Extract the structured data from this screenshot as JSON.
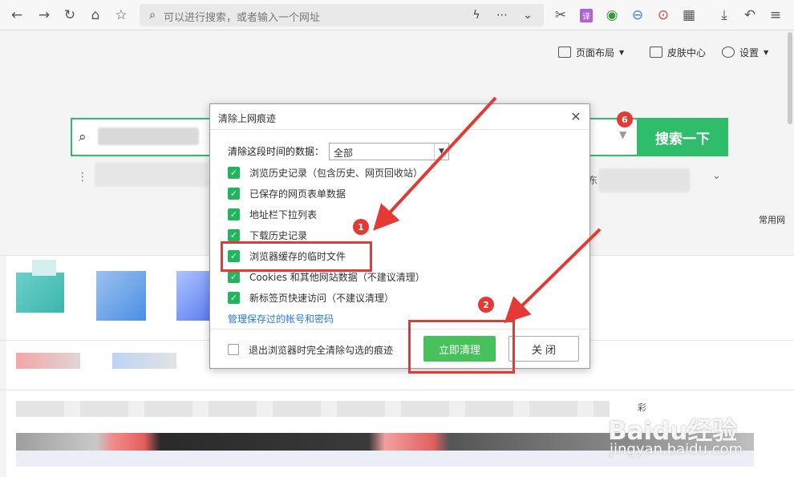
{
  "toolbar": {
    "address_placeholder": "可以进行搜索，或者输入一个网址",
    "translate_label": "译"
  },
  "homepage": {
    "layout_label": "页面布局",
    "skin_label": "皮肤中心",
    "settings_label": "设置",
    "search_button": "搜索一下",
    "frequent_label": "常用网",
    "partial_text_1": "东",
    "partial_text_2": "彩"
  },
  "dialog": {
    "title": "清除上网痕迹",
    "range_label": "清除这段时间的数据：",
    "range_value": "全部",
    "options": [
      {
        "label": "浏览历史记录（包含历史、网页回收站）",
        "checked": true
      },
      {
        "label": "已保存的网页表单数据",
        "checked": true
      },
      {
        "label": "地址栏下拉列表",
        "checked": true
      },
      {
        "label": "下载历史记录",
        "checked": true
      },
      {
        "label": "浏览器缓存的临时文件",
        "checked": true
      },
      {
        "label": "Cookies 和其他网站数据（不建议清理）",
        "checked": true
      },
      {
        "label": "新标签页快速访问（不建议清理）",
        "checked": true
      }
    ],
    "manage_link": "管理保存过的帐号和密码",
    "exit_option": "退出浏览器时完全清除勾选的痕迹",
    "clear_button": "立即清理",
    "close_button": "关 闭"
  },
  "annotations": {
    "badge_1": "1",
    "badge_2": "2",
    "badge_6": "6"
  },
  "watermark": {
    "brand": "Baidu经验",
    "url": "jingyan.baidu.com"
  },
  "colors": {
    "accent_green": "#2fbd6b",
    "highlight_red": "#e53935",
    "checkbox_green": "#22b55e"
  }
}
